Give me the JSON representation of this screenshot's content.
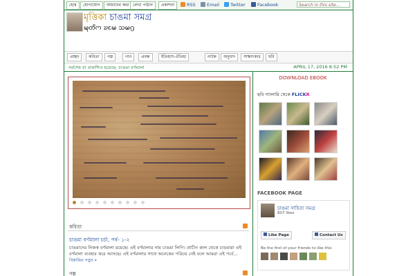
{
  "topbar": {
    "links": [
      "হোম",
      "যোগাযোগ",
      "আমাদের কথা",
      "লেখা পাঠান",
      "প্রকাশনা"
    ],
    "social": [
      {
        "label": "RSS",
        "color": "#f08a24",
        "icon": "rss-icon"
      },
      {
        "label": "Email",
        "color": "#7a8fa8",
        "icon": "email-icon"
      },
      {
        "label": "Twitter",
        "color": "#38a1f3",
        "icon": "twitter-icon"
      },
      {
        "label": "Facebook",
        "color": "#3b5998",
        "icon": "facebook-icon"
      }
    ],
    "search_placeholder": "Search in this site..."
  },
  "header": {
    "title_part1": "মৃত্তিকা",
    "title_part2": "চাঙমা সমগ্র",
    "subtitle": "𑄟𑄪𑄖𑄨𑄇 𑄌𑄋𑄟 𑄥𑄟𑄉𑄳𑄢"
  },
  "nav": [
    "প্রচ্ছদ",
    "কবিতা",
    "গল্প",
    "গান",
    "প্রবন্ধ",
    "ইতিহাস-ঐতিহ্য",
    "নাটক",
    "অনুবাদ",
    "সাক্ষাৎকার",
    "ছবি"
  ],
  "ticker": {
    "text": "সর্বশেষ যা প্রকাশিত হয়েছে:  চাঙমা বর্ণমালা",
    "date": "APRIL 17, 2016 8:52 PM"
  },
  "slider": {
    "dot_count": 10,
    "active_index": 0
  },
  "sections": {
    "first": "কবিতা",
    "second": "গল্প"
  },
  "post": {
    "title": "চাঙমা বর্ণমালা চর্চা, পর্ব- ১-২",
    "text": "চাঙমাদের নিজস্ব বর্ণমালা রয়েছে। এই বর্ণমালার নাম চাঙমা লিপি। প্রাচীন কাল থেকে চাঙমারা এই বর্ণমালা ব্যবহার করে আসছে। এই বর্ণমালার সাথে অনেকের পরিচয় নেই বলে আমরা এই পর্বে...",
    "more": "বিস্তারিত পড়ুন »"
  },
  "sidebar": {
    "ebook": "DOWNLOAD EBOOK",
    "flickr_prefix": "ছবি গ্যালারি থেকে",
    "flickr_a": "FLICK",
    "flickr_b": "R",
    "facebook_head": "FACEBOOK PAGE",
    "fb_name": "চাঙমা সাহিত্য সমগ্র",
    "fb_likes": "807 likes",
    "fb_like_btn": "Like Page",
    "fb_contact_btn": "Contact Us",
    "fb_friends": "Be the first of your friends to like this"
  }
}
